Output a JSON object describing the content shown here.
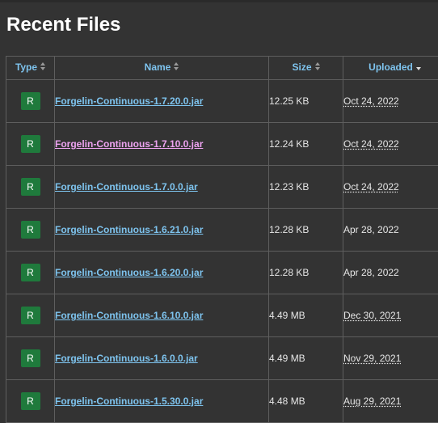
{
  "page": {
    "title": "Recent Files"
  },
  "table": {
    "headers": {
      "type": "Type",
      "name": "Name",
      "size": "Size",
      "uploaded": "Uploaded"
    },
    "sort": {
      "column": "uploaded",
      "direction": "descending"
    },
    "rows": [
      {
        "type": "R",
        "name": "Forgelin-Continuous-1.7.20.0.jar",
        "size": "12.25 KB",
        "uploaded": "Oct 24, 2022",
        "visited": false,
        "date_underlined": true
      },
      {
        "type": "R",
        "name": "Forgelin-Continuous-1.7.10.0.jar",
        "size": "12.24 KB",
        "uploaded": "Oct 24, 2022",
        "visited": true,
        "date_underlined": true
      },
      {
        "type": "R",
        "name": "Forgelin-Continuous-1.7.0.0.jar",
        "size": "12.23 KB",
        "uploaded": "Oct 24, 2022",
        "visited": false,
        "date_underlined": true
      },
      {
        "type": "R",
        "name": "Forgelin-Continuous-1.6.21.0.jar",
        "size": "12.28 KB",
        "uploaded": "Apr 28, 2022",
        "visited": false,
        "date_underlined": false
      },
      {
        "type": "R",
        "name": "Forgelin-Continuous-1.6.20.0.jar",
        "size": "12.28 KB",
        "uploaded": "Apr 28, 2022",
        "visited": false,
        "date_underlined": false
      },
      {
        "type": "R",
        "name": "Forgelin-Continuous-1.6.10.0.jar",
        "size": "4.49 MB",
        "uploaded": "Dec 30, 2021",
        "visited": false,
        "date_underlined": true
      },
      {
        "type": "R",
        "name": "Forgelin-Continuous-1.6.0.0.jar",
        "size": "4.49 MB",
        "uploaded": "Nov 29, 2021",
        "visited": false,
        "date_underlined": true
      },
      {
        "type": "R",
        "name": "Forgelin-Continuous-1.5.30.0.jar",
        "size": "4.48 MB",
        "uploaded": "Aug 29, 2021",
        "visited": false,
        "date_underlined": true
      }
    ]
  },
  "colors": {
    "background": "#333333",
    "link": "#7ec4ef",
    "link_visited": "#eda3f0",
    "release_badge": "#1f7a3c",
    "border": "#5e5e5e"
  },
  "icons": {
    "sortable": "sort-both-icon",
    "sorted_desc": "sort-desc-icon"
  }
}
